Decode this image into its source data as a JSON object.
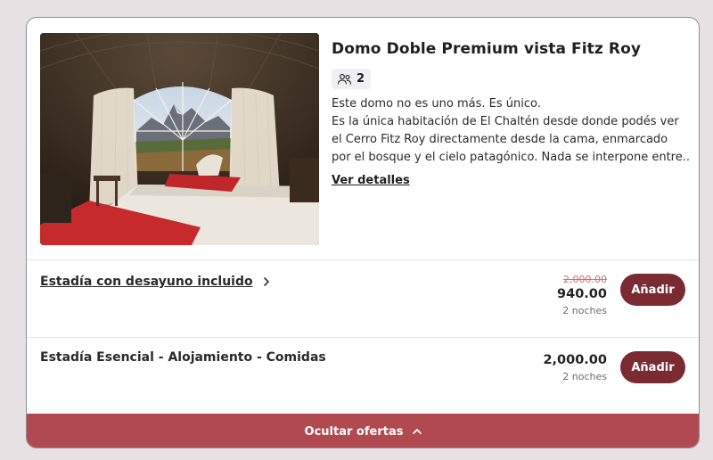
{
  "room": {
    "title": "Domo Doble Premium vista Fitz Roy",
    "guests": "2",
    "guest_icon": "people-icon",
    "description_lines": [
      "Este domo no es uno más. Es único.",
      "Es la única habitación de El Chaltén desde donde podés ver",
      "el Cerro Fitz Roy directamente desde la cama, enmarcado",
      "por el bosque y el cielo patagónico. Nada se interpone entre..."
    ],
    "details_link": "Ver detalles"
  },
  "offers": [
    {
      "name": "Estadía con desayuno incluido",
      "old_price": "2,000.00",
      "price": "940.00",
      "nights": "2 noches",
      "add_label": "Añadir"
    },
    {
      "name": "Estadía Esencial - Alojamiento - Comidas",
      "price": "2,000.00",
      "nights": "2 noches",
      "add_label": "Añadir"
    }
  ],
  "footer": {
    "toggle_label": "Ocultar ofertas"
  },
  "colors": {
    "accent": "#7a2a33",
    "bar": "#b14a50",
    "old_price": "#d07070"
  }
}
